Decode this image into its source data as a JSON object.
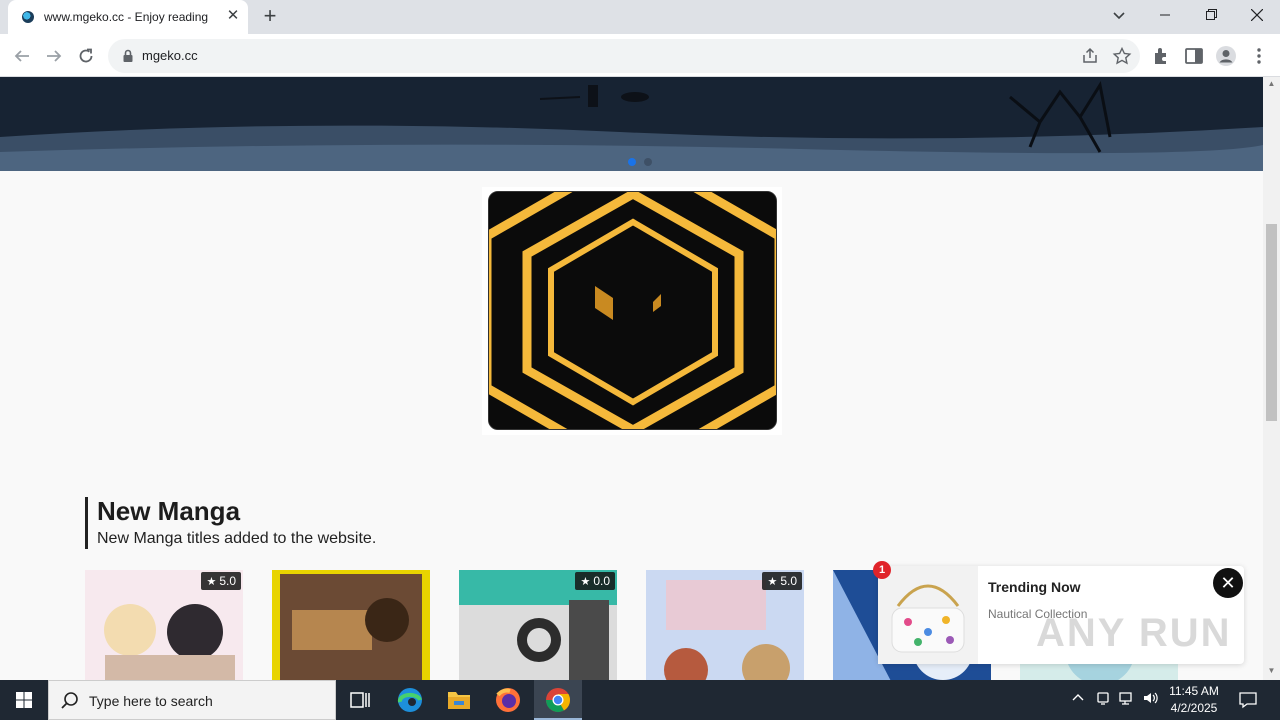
{
  "browser": {
    "tab_title": "www.mgeko.cc - Enjoy reading",
    "tab_close": "✕",
    "new_tab": "+",
    "url": "mgeko.cc"
  },
  "window": {
    "minimize": "—",
    "restore": "❐",
    "close": "✕",
    "tab_search": "⌄"
  },
  "page": {
    "banner_dots": 2,
    "section": {
      "title": "New Manga",
      "subtitle": "New Manga titles added to the website."
    },
    "cards": [
      {
        "rating": "5.0",
        "colors": [
          "#f7e9ee",
          "#e9d3c8",
          "#d3b9a7"
        ]
      },
      {
        "rating": "",
        "colors": [
          "#e8d400",
          "#6b4a34",
          "#b6864f"
        ]
      },
      {
        "rating": "0.0",
        "colors": [
          "#37b9a7",
          "#2c2c2c",
          "#d9d9d9"
        ]
      },
      {
        "rating": "5.0",
        "colors": [
          "#cbd9f2",
          "#f3c3c9",
          "#8d6a58"
        ]
      },
      {
        "rating": "",
        "colors": [
          "#1e4d96",
          "#8fb3e6",
          "#e6eef9"
        ]
      }
    ],
    "trending": {
      "count": "1",
      "title": "Trending Now",
      "subtitle": "Nautical Collection",
      "close": "✕"
    },
    "watermark": "ANY RUN"
  },
  "taskbar": {
    "search_placeholder": "Type here to search",
    "time": "11:45 AM",
    "date": "4/2/2025"
  },
  "colors": {
    "accent_dot": "#1a73e8",
    "ad_gold": "#f5b93b"
  }
}
